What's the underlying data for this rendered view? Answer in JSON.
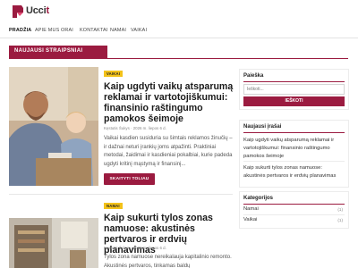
{
  "site": {
    "logo_text": "Ucci",
    "logo_suffix": "t"
  },
  "nav": {
    "items": [
      {
        "label": "PRADŽIA",
        "active": true
      },
      {
        "label": "APIE MUS",
        "active": false
      },
      {
        "label": "ORAI",
        "active": false
      },
      {
        "label": "KONTAKTAI",
        "active": false
      },
      {
        "label": "NAMAI",
        "active": false
      },
      {
        "label": "VAIKAI",
        "active": false
      }
    ]
  },
  "main": {
    "section_title": "NAUJAUSI STRAIPSNIAI",
    "posts": [
      {
        "category": "VAIKAI",
        "title": "Kaip ugdyti vaikų atsparumą reklamai ir vartotojiškumui: finansinio raštingumo pamokos šeimoje",
        "meta": "Kęstutis Šukys · 2026 m. liepos 6 d.",
        "excerpt": "Vaikai kasdien susiduria su šimtais reklamos žinučių – ir dažnai neturi įrankių joms atpažinti. Praktiniai metodai, žaidimai ir kasdieniai pokalbiai, kurie padeda ugdyti kritinį mąstymą ir finansinį...",
        "button": "SKAITYTI TOLIAU"
      },
      {
        "category": "NAMAI",
        "title": "Kaip sukurti tylos zonas namuose: akustinės pertvaros ir erdvių planavimas",
        "meta": "Kęstutis Šukys · 2026 m. liepos 6 d.",
        "excerpt": "Tylos zona namuose nereikalauja kapitalinio remonto. Akustinės pertvaros, tinkamas baldų"
      }
    ]
  },
  "sidebar": {
    "search": {
      "title": "Paieška",
      "placeholder": "Ieškoti...",
      "button": "IEŠKOTI"
    },
    "recent": {
      "title": "Naujausi įrašai",
      "items": [
        "Kaip ugdyti vaikų atsparumą reklamai ir vartotojiškumui: finansinio raštingumo pamokos šeimoje",
        "Kaip sukurti tylos zonas namuose: akustinės pertvaros ir erdvių planavimas"
      ]
    },
    "categories": {
      "title": "Kategorijos",
      "items": [
        {
          "name": "Namai",
          "count": "(1)"
        },
        {
          "name": "Vaikai",
          "count": "(1)"
        }
      ]
    }
  },
  "colors": {
    "accent": "#9b1b40",
    "badge": "#f3c21a"
  }
}
